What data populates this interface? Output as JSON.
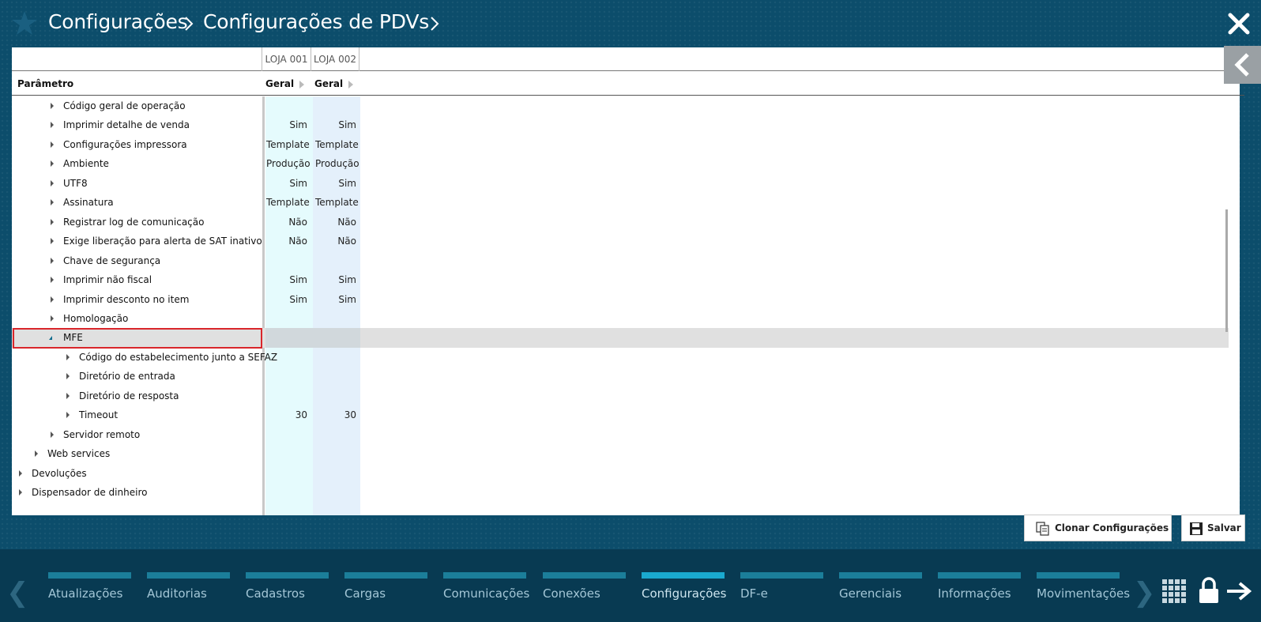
{
  "breadcrumb": {
    "root": "Configurações",
    "current": "Configurações de PDVs"
  },
  "grid": {
    "columns": [
      "LOJA 001",
      "LOJA 002"
    ],
    "param_header": "Parâmetro",
    "group_header": "Geral"
  },
  "rows": [
    {
      "label": "Código geral de operação",
      "v1": "",
      "v2": ""
    },
    {
      "label": "Imprimir detalhe de venda",
      "v1": "Sim",
      "v2": "Sim"
    },
    {
      "label": "Configurações impressora",
      "v1": "Template",
      "v2": "Template"
    },
    {
      "label": "Ambiente",
      "v1": "Produção",
      "v2": "Produção"
    },
    {
      "label": "UTF8",
      "v1": "Sim",
      "v2": "Sim"
    },
    {
      "label": "Assinatura",
      "v1": "Template",
      "v2": "Template"
    },
    {
      "label": "Registrar log de comunicação",
      "v1": "Não",
      "v2": "Não"
    },
    {
      "label": "Exige liberação para alerta de SAT inativo",
      "v1": "Não",
      "v2": "Não"
    },
    {
      "label": "Chave de segurança",
      "v1": "",
      "v2": ""
    },
    {
      "label": "Imprimir não fiscal",
      "v1": "Sim",
      "v2": "Sim"
    },
    {
      "label": "Imprimir desconto no item",
      "v1": "Sim",
      "v2": "Sim"
    },
    {
      "label": "Homologação",
      "v1": "",
      "v2": ""
    },
    {
      "label": "MFE",
      "v1": "",
      "v2": ""
    },
    {
      "label": "Código do estabelecimento junto a SEFAZ",
      "v1": "",
      "v2": ""
    },
    {
      "label": "Diretório de entrada",
      "v1": "",
      "v2": ""
    },
    {
      "label": "Diretório de resposta",
      "v1": "",
      "v2": ""
    },
    {
      "label": "Timeout",
      "v1": "30",
      "v2": "30"
    },
    {
      "label": "Servidor remoto",
      "v1": "",
      "v2": ""
    },
    {
      "label": "Web services",
      "v1": "",
      "v2": ""
    },
    {
      "label": "Devoluções",
      "v1": "",
      "v2": ""
    },
    {
      "label": "Dispensador de dinheiro",
      "v1": "",
      "v2": ""
    }
  ],
  "buttons": {
    "clone": "Clonar Configurações",
    "save": "Salvar"
  },
  "nav": {
    "items": [
      "Atualizações",
      "Auditorias",
      "Cadastros",
      "Cargas",
      "Comunicações",
      "Conexões",
      "Configurações",
      "DF-e",
      "Gerenciais",
      "Informações",
      "Movimentações"
    ],
    "active": "Configurações"
  },
  "colors": {
    "background": "#0c4d6b",
    "bottom_bar": "#083a52",
    "nav_accent": "#1b7e9a",
    "nav_active": "#1aa9cf",
    "selection_border": "#d9262b"
  },
  "icons": [
    "star-icon",
    "chevron-right-icon",
    "close-icon",
    "chevron-left-icon",
    "expand-arrow-icon",
    "collapse-arrow-icon",
    "clone-icon",
    "save-icon",
    "grid-icon",
    "lock-icon",
    "arrow-right-icon"
  ]
}
